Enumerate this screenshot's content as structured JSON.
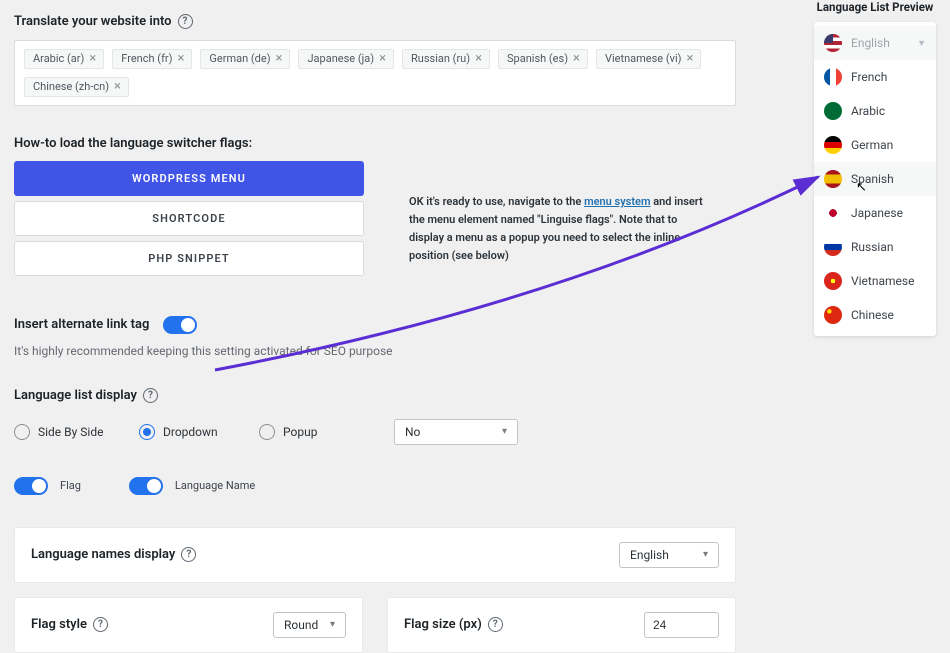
{
  "translate_section": {
    "label": "Translate your website into",
    "chips": [
      "Arabic (ar)",
      "French (fr)",
      "German (de)",
      "Japanese (ja)",
      "Russian (ru)",
      "Spanish (es)",
      "Vietnamese (vi)",
      "Chinese (zh-cn)"
    ]
  },
  "loader_section": {
    "label": "How-to load the language switcher flags:",
    "btn_primary": "WORDPRESS MENU",
    "btn_shortcode": "SHORTCODE",
    "btn_php": "PHP SNIPPET",
    "info_pre": "OK it's ready to use, navigate to the ",
    "info_link": "menu system",
    "info_post": " and insert the menu element named \"Linguise flags\". Note that to display a menu as a popup you need to select the inline position (see below)"
  },
  "alt_link": {
    "label": "Insert alternate link tag",
    "hint": "It's highly recommended keeping this setting activated for SEO purpose"
  },
  "display_section": {
    "label": "Language list display",
    "radio_side": "Side By Side",
    "radio_dropdown": "Dropdown",
    "radio_popup": "Popup",
    "select_value": "No",
    "toggle_flag": "Flag",
    "toggle_langname": "Language Name"
  },
  "names_display": {
    "label": "Language names display",
    "value": "English"
  },
  "flag_style": {
    "label": "Flag style",
    "value": "Round"
  },
  "flag_size": {
    "label": "Flag size (px)",
    "value": "24"
  },
  "preview": {
    "title": "Language List Preview",
    "items": [
      {
        "lang": "English",
        "flag": "us",
        "head": true
      },
      {
        "lang": "French",
        "flag": "fr"
      },
      {
        "lang": "Arabic",
        "flag": "ar"
      },
      {
        "lang": "German",
        "flag": "de"
      },
      {
        "lang": "Spanish",
        "flag": "es",
        "hover": true
      },
      {
        "lang": "Japanese",
        "flag": "jp"
      },
      {
        "lang": "Russian",
        "flag": "ru"
      },
      {
        "lang": "Vietnamese",
        "flag": "vn"
      },
      {
        "lang": "Chinese",
        "flag": "cn"
      }
    ]
  }
}
